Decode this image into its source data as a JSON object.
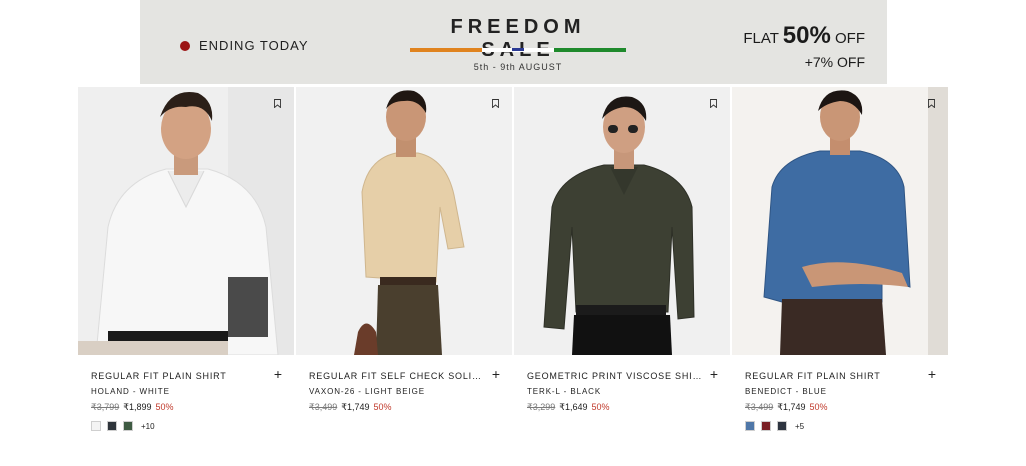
{
  "banner": {
    "ending": "ENDING TODAY",
    "title": "FREEDOM SALE",
    "dates": "5th - 9th AUGUST",
    "flat_prefix": "FLAT ",
    "flat_value": "50%",
    "flat_suffix": " OFF",
    "extra": "+7% OFF"
  },
  "products": [
    {
      "title": "REGULAR FIT PLAIN SHIRT",
      "brand": "HOLAND - WHITE",
      "mrp": "₹3,799",
      "price": "₹1,899",
      "discount": "50%",
      "swatches": [
        "#f4f4f4",
        "#2f353b",
        "#3f5b43"
      ],
      "more": "+10"
    },
    {
      "title": "REGULAR FIT SELF CHECK SOLID SHIRT",
      "brand": "VAXON-26 - LIGHT BEIGE",
      "mrp": "₹3,499",
      "price": "₹1,749",
      "discount": "50%",
      "swatches": [],
      "more": ""
    },
    {
      "title": "GEOMETRIC PRINT VISCOSE SHIRT",
      "brand": "TERK-L - BLACK",
      "mrp": "₹3,299",
      "price": "₹1,649",
      "discount": "50%",
      "swatches": [],
      "more": ""
    },
    {
      "title": "REGULAR FIT PLAIN SHIRT",
      "brand": "BENEDICT - BLUE",
      "mrp": "₹3,499",
      "price": "₹1,749",
      "discount": "50%",
      "swatches": [
        "#4f77a8",
        "#7a1f25",
        "#2e3440"
      ],
      "more": "+5"
    }
  ],
  "icons": {
    "bookmark": "bookmark-icon",
    "add": "plus-icon"
  },
  "colors": {
    "discount": "#c0392b",
    "banner_dot": "#9b1414",
    "tricolor": [
      "#e0831f",
      "#ffffff",
      "#1f8a2c"
    ]
  }
}
